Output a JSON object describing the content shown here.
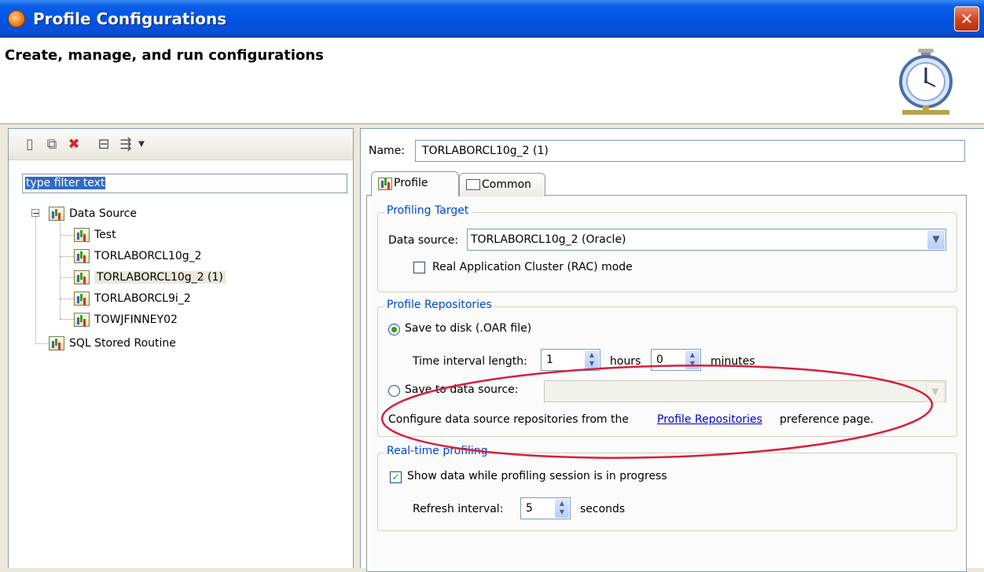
{
  "window": {
    "title": "Profile Configurations",
    "close_glyph": "✕"
  },
  "header": {
    "title": "Create, manage, and run configurations",
    "icon": "stopwatch-icon"
  },
  "left": {
    "toolbar": {
      "icons": [
        "new-configuration-icon",
        "duplicate-icon",
        "delete-icon",
        "collapse-all-icon",
        "filter-icon",
        "dropdown-icon"
      ]
    },
    "filter": {
      "placeholder": "type filter text"
    },
    "tree": {
      "root1": "Data Source",
      "children": [
        "Test",
        "TORLABORCL10g_2",
        "TORLABORCL10g_2 (1)",
        "TORLABORCL9i_2",
        "TOWJFINNEY02"
      ],
      "root2": "SQL Stored Routine"
    }
  },
  "right": {
    "name_label": "Name:",
    "name_value": "TORLABORCL10g_2 (1)",
    "tabs": [
      "Profile",
      "Common"
    ],
    "profiling_target": {
      "title": "Profiling Target",
      "data_source_label": "Data source:",
      "data_source_value": "TORLABORCL10g_2 (Oracle)",
      "rac_label": "Real Application Cluster (RAC) mode"
    },
    "repositories": {
      "title": "Profile Repositories",
      "save_disk_label": "Save to disk (.OAR file)",
      "interval_label": "Time interval length:",
      "hours_value": "1",
      "hours_label": "hours",
      "minutes_value": "0",
      "minutes_label": "minutes",
      "save_ds_label": "Save to data source:",
      "configure_prefix": "Configure data source repositories from the",
      "configure_link": "Profile Repositories",
      "configure_suffix": "preference page."
    },
    "realtime": {
      "title": "Real-time profiling",
      "show_data_label": "Show data while profiling session is in progress",
      "refresh_label": "Refresh interval:",
      "refresh_value": "5",
      "seconds_label": "seconds"
    }
  },
  "colors": {
    "titlebar": "#0054e3",
    "link": "#0000cc",
    "group_title": "#0046d5",
    "annotation": "#d81e3c"
  }
}
